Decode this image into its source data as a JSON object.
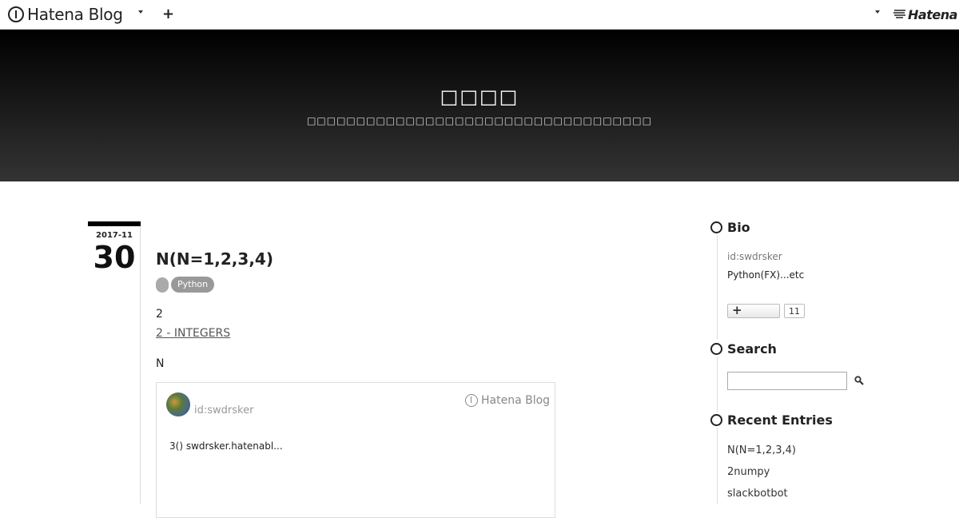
{
  "topbar": {
    "logo_text": "Hatena Blog",
    "hatena_text": "Hatena"
  },
  "header": {
    "title": "□□□□",
    "description": "□□□□□□□□□□□□□□□□□□□□□□□□□□□□□□□□□□□"
  },
  "entry": {
    "date_ym": "2017-11",
    "date_day": "30",
    "title": "N(N=1,2,3,4)",
    "category": "Python",
    "para1": "2",
    "link_text": "2 - INTEGERS",
    "para2": "N",
    "embed": {
      "user_id": "id:swdrsker",
      "logo_text": "Hatena Blog",
      "excerpt": "3() swdrsker.hatenabl..."
    }
  },
  "sidebar": {
    "bio": {
      "heading": "Bio",
      "user_id": "id:swdrsker",
      "text": "Python(FX)...etc",
      "follow_icon": "+",
      "follow_count": "11"
    },
    "search": {
      "heading": "Search",
      "placeholder": ""
    },
    "recent": {
      "heading": "Recent Entries",
      "items": [
        "N(N=1,2,3,4)",
        "2numpy",
        "slackbotbot"
      ]
    }
  }
}
